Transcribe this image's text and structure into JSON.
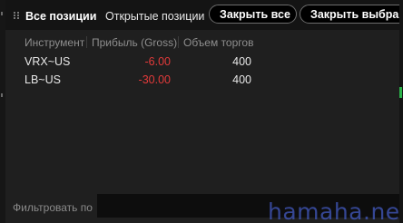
{
  "tabs": {
    "all_positions": "Все позиции",
    "open_positions": "Открытые позиции"
  },
  "buttons": {
    "close_all": "Закрыть все",
    "close_selected": "Закрыть выбранн"
  },
  "table": {
    "columns": [
      "Инструмент",
      "Прибыль (Gross)",
      "Объем торгов"
    ],
    "rows": [
      {
        "instrument": "VRX~US",
        "profit": "-6.00",
        "volume": "400"
      },
      {
        "instrument": "LB~US",
        "profit": "-30.00",
        "volume": "400"
      }
    ]
  },
  "filter": {
    "label": "Фильтровать по",
    "value": ""
  },
  "watermark": "hamaha.net",
  "colors": {
    "background": "#1f1f1f",
    "header_bar": "#141414",
    "negative": "#e23a3a",
    "watermark": "#3f55b5"
  }
}
